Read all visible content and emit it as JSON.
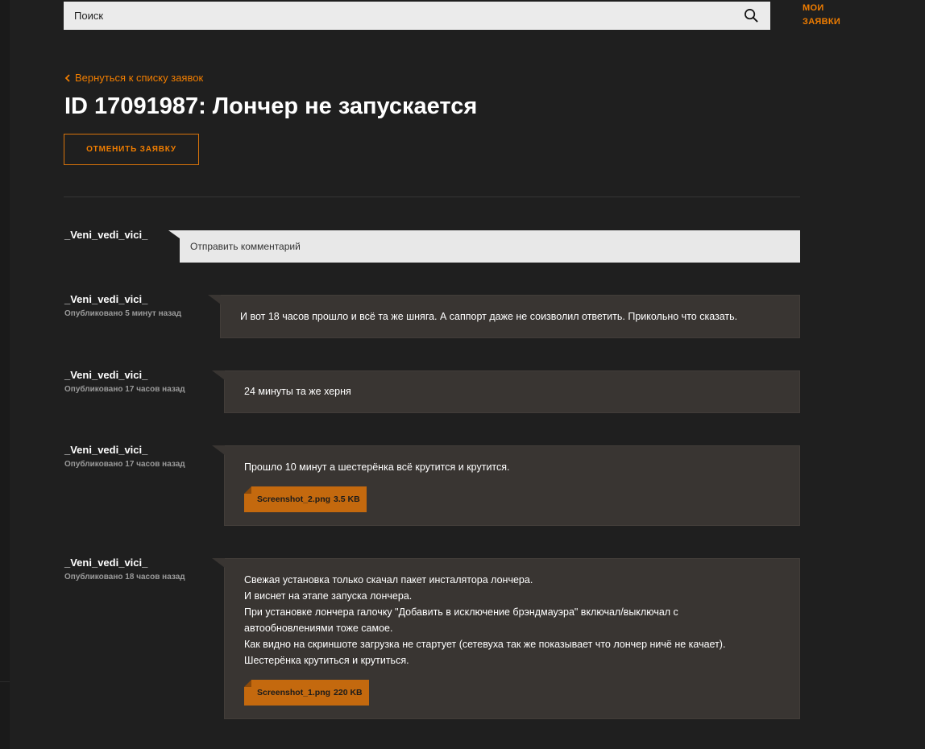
{
  "header": {
    "search_placeholder": "Поиск",
    "my_requests": "МОИ\nЗАЯВКИ"
  },
  "ticket": {
    "back_link": "Вернуться к списку заявок",
    "title": "ID 17091987: Лончер не запускается",
    "cancel_label": "ОТМЕНИТЬ ЗАЯВКУ"
  },
  "composer": {
    "author": "_Veni_vedi_vici_",
    "placeholder": "Отправить комментарий"
  },
  "comments": [
    {
      "author": "_Veni_vedi_vici_",
      "date": "Опубликовано 5 минут назад",
      "text": "И вот 18 часов прошло и всё та же шняга. А саппорт даже не соизволил ответить. Прикольно что сказать."
    },
    {
      "author": "_Veni_vedi_vici_",
      "date": "Опубликовано 17 часов назад",
      "text": "24 минуты та же херня"
    },
    {
      "author": "_Veni_vedi_vici_",
      "date": "Опубликовано 17 часов назад",
      "text": "Прошло 10 минут а шестерёнка всё крутится и крутится.",
      "attachment": {
        "name": "Screenshot_2.png",
        "size": "3.5 KB"
      }
    },
    {
      "author": "_Veni_vedi_vici_",
      "date": "Опубликовано 18 часов назад",
      "text": "Свежая установка только скачал пакет инсталятора лончера.\nИ виснет на этапе запуска лончера.\nПри установке лончера галочку \"Добавить в исключение брэндмауэра\" включал/выключал с\nавтообновлениями тоже самое.\nКак видно на скриншоте загрузка не стартует (сетевуха так же показывает что лончер ничё не качает).\nШестерёнка крутиться и крутиться.",
      "attachment": {
        "name": "Screenshot_1.png",
        "size": "220 KB"
      }
    }
  ],
  "colors": {
    "background": "#1f1f1f",
    "accent": "#f07d00",
    "bubble": "#393532",
    "attachment": "#c4690e"
  }
}
